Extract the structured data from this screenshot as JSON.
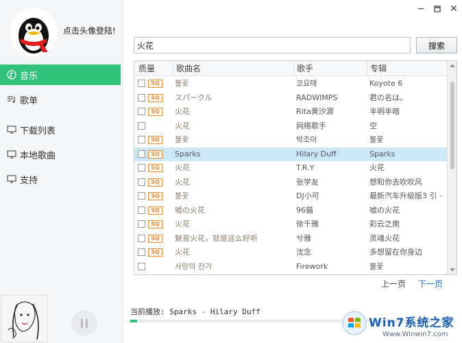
{
  "window": {
    "minimize_label": "−",
    "close_label": "✕"
  },
  "sidebar": {
    "login_text": "点击头像登陆!",
    "items": [
      {
        "label": "音乐",
        "icon": "music-note-icon",
        "active": true
      },
      {
        "label": "歌单",
        "icon": "playlist-icon",
        "active": false
      },
      {
        "label": "下载列表",
        "icon": "monitor-icon",
        "active": false
      },
      {
        "label": "本地歌曲",
        "icon": "monitor-icon",
        "active": false
      },
      {
        "label": "支持",
        "icon": "monitor-icon",
        "active": false
      }
    ]
  },
  "search": {
    "value": "火花",
    "button_label": "搜索"
  },
  "table": {
    "columns": [
      "质量",
      "歌曲名",
      "歌手",
      "专辑"
    ],
    "badge_label": "SQ",
    "rows": [
      {
        "sq": true,
        "song": "불꽃",
        "artist": "코요태",
        "album": "Koyote 6",
        "selected": false
      },
      {
        "sq": true,
        "song": "スパークル",
        "artist": "RADWIMPS",
        "album": "君の名は。",
        "selected": false
      },
      {
        "sq": true,
        "song": "火花",
        "artist": "Rita黄汐源",
        "album": "半明半暗",
        "selected": false
      },
      {
        "sq": false,
        "song": "火花",
        "artist": "网络歌手",
        "album": "空",
        "selected": false
      },
      {
        "sq": true,
        "song": "불꽃",
        "artist": "박조아",
        "album": "불꽃",
        "selected": false
      },
      {
        "sq": true,
        "song": "Sparks",
        "artist": "Hilary Duff",
        "album": "Sparks",
        "selected": true
      },
      {
        "sq": true,
        "song": "火花",
        "artist": "T.R.Y",
        "album": "火花",
        "selected": false
      },
      {
        "sq": true,
        "song": "火花",
        "artist": "张学友",
        "album": "想和你去吹吹风",
        "selected": false
      },
      {
        "sq": true,
        "song": "불꽃",
        "artist": "DJ小可",
        "album": "最新汽车升级版3 引 -",
        "selected": false
      },
      {
        "sq": true,
        "song": "嘘の火花",
        "artist": "96猫",
        "album": "嘘の火花",
        "selected": false
      },
      {
        "sq": true,
        "song": "火花",
        "artist": "徐千雅",
        "album": "彩云之南",
        "selected": false
      },
      {
        "sq": true,
        "song": "魅音火花，就是这么好听",
        "artist": "兮雅",
        "album": "灵魂火花",
        "selected": false
      },
      {
        "sq": true,
        "song": "火花",
        "artist": "沈念",
        "album": "多想留在你身边",
        "selected": false
      },
      {
        "sq": false,
        "song": "사랑의 잔가",
        "artist": "Firework",
        "album": "불꽃",
        "selected": false
      }
    ]
  },
  "pagination": {
    "prev_label": "上一页",
    "next_label": "下一页"
  },
  "player": {
    "now_playing": "当前播放: Sparks - Hilary Duff",
    "progress": 0.02
  },
  "watermark": {
    "brand": "Win7系统之家",
    "url": "Www.Winwin7.com"
  },
  "colors": {
    "accent": "#31c27c",
    "link": "#1a6fd1",
    "selected_row": "#cce8f6",
    "sq_badge": "#f08a2a"
  }
}
